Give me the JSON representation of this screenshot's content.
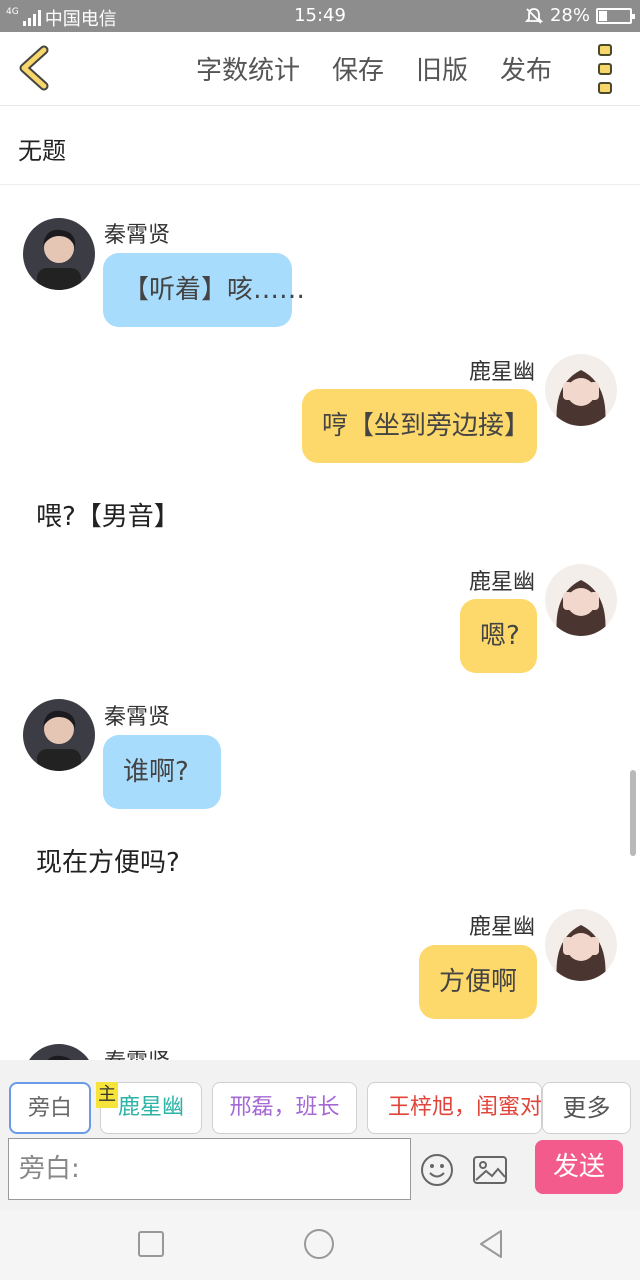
{
  "status_bar": {
    "network_label": "4G",
    "carrier": "中国电信",
    "time": "15:49",
    "battery_text": "28%",
    "battery_level": 0.28,
    "icons": [
      "signal-icon",
      "mute-bell-icon",
      "battery-icon"
    ]
  },
  "toolbar": {
    "word_count_label": "字数统计",
    "save_label": "保存",
    "old_version_label": "旧版",
    "publish_label": "发布"
  },
  "story": {
    "title": "无题"
  },
  "messages": [
    {
      "type": "left",
      "name": "秦霄贤",
      "text": "【听着】咳……"
    },
    {
      "type": "right",
      "name": "鹿星幽",
      "text": "哼【坐到旁边接】"
    },
    {
      "type": "narration",
      "text": "喂?【男音】"
    },
    {
      "type": "right",
      "name": "鹿星幽",
      "text": "嗯?"
    },
    {
      "type": "left",
      "name": "秦霄贤",
      "text": "谁啊?"
    },
    {
      "type": "narration",
      "text": "现在方便吗?"
    },
    {
      "type": "right",
      "name": "鹿星幽",
      "text": "方便啊"
    },
    {
      "type": "left",
      "name": "秦霄贤",
      "text": ""
    }
  ],
  "roles": {
    "narrator": "旁白",
    "host_badge": "主",
    "role1": "鹿星幽",
    "role2": "邢磊，班长",
    "role3": "王梓旭，闺蜜对象",
    "more": "更多"
  },
  "composer": {
    "placeholder": "旁白:",
    "send_label": "发送"
  },
  "colors": {
    "blue_bubble": "#a8dcfc",
    "yellow_bubble": "#fdd86b",
    "send_button": "#f45b8d",
    "role1_color": "#2bb3a5",
    "role2_color": "#a569d6",
    "role3_color": "#e0443a",
    "accent_yellow": "#f7d66b"
  }
}
